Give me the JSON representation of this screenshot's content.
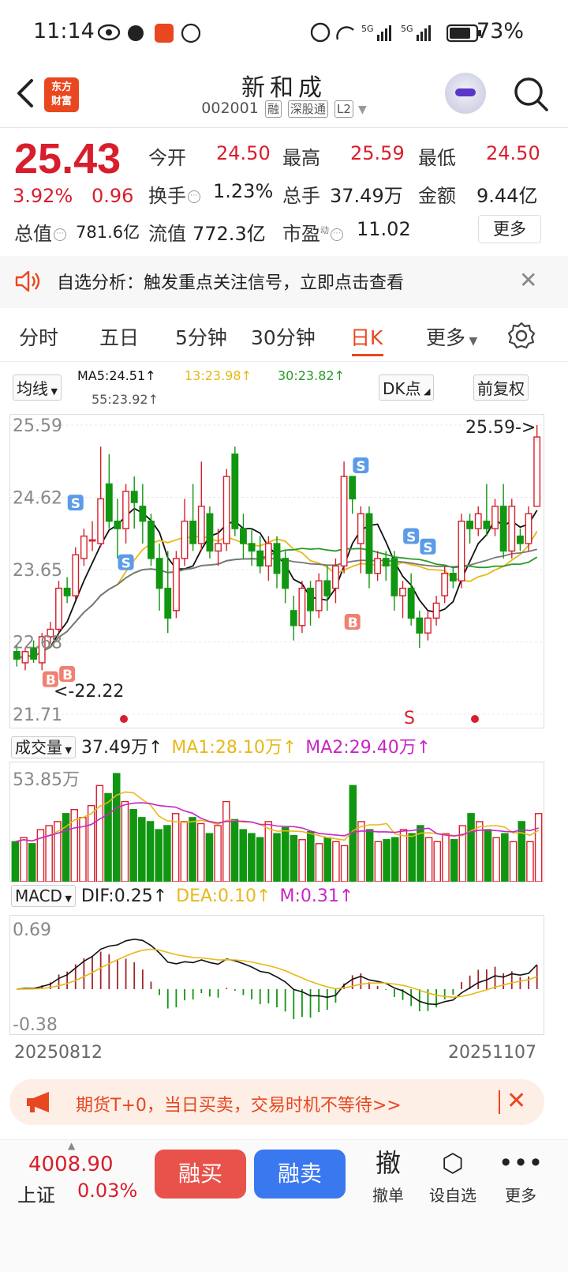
{
  "status_bar": {
    "time": "11:14",
    "battery": "73%"
  },
  "header": {
    "logo_line1": "东方",
    "logo_line2": "财富",
    "stock_name": "新和成",
    "stock_code": "002001",
    "tags": [
      "融",
      "深股通",
      "L2"
    ]
  },
  "quote": {
    "price": "25.43",
    "change_pct": "3.92%",
    "change_amt": "0.96",
    "stats": [
      {
        "label": "今开",
        "value": "24.50",
        "color": "red"
      },
      {
        "label": "最高",
        "value": "25.59",
        "color": "red"
      },
      {
        "label": "最低",
        "value": "24.50",
        "color": "red"
      },
      {
        "label": "换手",
        "value": "1.23%",
        "color": "black"
      },
      {
        "label": "总手",
        "value": "37.49万",
        "color": "black"
      },
      {
        "label": "金额",
        "value": "9.44亿",
        "color": "black"
      },
      {
        "label": "总值",
        "value": "781.6亿",
        "color": "black"
      },
      {
        "label": "流值",
        "value": "772.3亿",
        "color": "black"
      },
      {
        "label": "市盈",
        "value": "11.02",
        "color": "black"
      }
    ],
    "pe_sup": "动",
    "more_label": "更多"
  },
  "notice": {
    "text": "自选分析：触发重点关注信号，立即点击查看"
  },
  "tabs": [
    "分时",
    "五日",
    "5分钟",
    "30分钟",
    "日K",
    "更多"
  ],
  "active_tab": "日K",
  "ma_legend": {
    "selector": "均线",
    "ma5": "MA5:24.51",
    "ma13": "13:23.98",
    "ma30": "30:23.82",
    "ma55": "55:23.92",
    "dk_label": "DK点",
    "adj_label": "前复权"
  },
  "colors": {
    "up": "#d81e2c",
    "down": "#119611",
    "ma5": "#111111",
    "ma13": "#e8b818",
    "ma30": "#2a9a2a",
    "ma55": "#777777",
    "accent": "#e8471f",
    "sell_blue": "#3a78f0"
  },
  "price_chart": {
    "y_labels": [
      "25.59",
      "24.62",
      "23.65",
      "22.68",
      "21.71"
    ],
    "high_marker": "25.59->",
    "low_marker": "22.22",
    "signal_s": "S",
    "signal_b": "B"
  },
  "volume_panel": {
    "selector": "成交量",
    "value": "37.49万",
    "ma1": "MA1:28.10万",
    "ma2": "MA2:29.40万",
    "y_label": "53.85万"
  },
  "macd_panel": {
    "selector": "MACD",
    "dif": "DIF:0.25",
    "dea": "DEA:0.10",
    "m": "M:0.31",
    "y_top": "0.69",
    "y_bottom": "-0.38"
  },
  "date_axis": {
    "start": "20250812",
    "end": "20251107"
  },
  "chart_data": {
    "type": "candlestick",
    "y_range": [
      21.71,
      25.59
    ],
    "candles": [
      {
        "o": 22.55,
        "c": 22.45,
        "h": 22.65,
        "l": 22.35
      },
      {
        "o": 22.4,
        "c": 22.55,
        "h": 22.6,
        "l": 22.3
      },
      {
        "o": 22.6,
        "c": 22.45,
        "h": 22.7,
        "l": 22.4
      },
      {
        "o": 22.4,
        "c": 22.75,
        "h": 22.8,
        "l": 22.3
      },
      {
        "o": 22.75,
        "c": 22.85,
        "h": 22.95,
        "l": 22.65
      },
      {
        "o": 22.85,
        "c": 23.4,
        "h": 23.5,
        "l": 22.8
      },
      {
        "o": 23.4,
        "c": 23.3,
        "h": 23.55,
        "l": 23.2
      },
      {
        "o": 23.3,
        "c": 23.85,
        "h": 23.95,
        "l": 23.25
      },
      {
        "o": 23.8,
        "c": 24.1,
        "h": 24.2,
        "l": 23.7
      },
      {
        "o": 24.05,
        "c": 24.05,
        "h": 24.3,
        "l": 23.9
      },
      {
        "o": 24.0,
        "c": 24.6,
        "h": 25.3,
        "l": 23.95
      },
      {
        "o": 24.8,
        "c": 24.3,
        "h": 25.2,
        "l": 24.2
      },
      {
        "o": 24.3,
        "c": 24.2,
        "h": 24.6,
        "l": 23.8
      },
      {
        "o": 24.2,
        "c": 24.7,
        "h": 24.8,
        "l": 24.0
      },
      {
        "o": 24.7,
        "c": 24.55,
        "h": 24.9,
        "l": 24.2
      },
      {
        "o": 24.5,
        "c": 24.3,
        "h": 24.8,
        "l": 24.0
      },
      {
        "o": 24.3,
        "c": 23.8,
        "h": 24.4,
        "l": 23.7
      },
      {
        "o": 23.8,
        "c": 23.4,
        "h": 24.0,
        "l": 23.1
      },
      {
        "o": 23.4,
        "c": 23.0,
        "h": 23.9,
        "l": 22.8
      },
      {
        "o": 23.1,
        "c": 23.8,
        "h": 23.9,
        "l": 23.0
      },
      {
        "o": 23.8,
        "c": 24.3,
        "h": 24.6,
        "l": 23.7
      },
      {
        "o": 24.3,
        "c": 24.0,
        "h": 24.8,
        "l": 23.9
      },
      {
        "o": 24.0,
        "c": 24.5,
        "h": 25.1,
        "l": 23.9
      },
      {
        "o": 24.4,
        "c": 23.9,
        "h": 24.5,
        "l": 23.8
      },
      {
        "o": 23.9,
        "c": 24.0,
        "h": 24.2,
        "l": 23.7
      },
      {
        "o": 24.0,
        "c": 24.9,
        "h": 25.0,
        "l": 23.9
      },
      {
        "o": 25.2,
        "c": 24.2,
        "h": 25.3,
        "l": 24.1
      },
      {
        "o": 24.2,
        "c": 24.0,
        "h": 24.4,
        "l": 23.8
      },
      {
        "o": 24.0,
        "c": 23.9,
        "h": 24.2,
        "l": 23.7
      },
      {
        "o": 23.9,
        "c": 23.7,
        "h": 24.1,
        "l": 23.6
      },
      {
        "o": 23.7,
        "c": 24.0,
        "h": 24.1,
        "l": 23.5
      },
      {
        "o": 24.0,
        "c": 23.6,
        "h": 24.1,
        "l": 23.4
      },
      {
        "o": 23.8,
        "c": 23.4,
        "h": 23.9,
        "l": 23.2
      },
      {
        "o": 23.1,
        "c": 22.9,
        "h": 23.3,
        "l": 22.7
      },
      {
        "o": 22.9,
        "c": 23.4,
        "h": 23.5,
        "l": 22.8
      },
      {
        "o": 23.4,
        "c": 23.1,
        "h": 23.5,
        "l": 22.9
      },
      {
        "o": 23.1,
        "c": 23.5,
        "h": 23.6,
        "l": 23.0
      },
      {
        "o": 23.5,
        "c": 23.3,
        "h": 23.7,
        "l": 23.1
      },
      {
        "o": 23.4,
        "c": 23.7,
        "h": 23.8,
        "l": 23.2
      },
      {
        "o": 23.7,
        "c": 24.9,
        "h": 25.1,
        "l": 23.6
      },
      {
        "o": 24.9,
        "c": 24.6,
        "h": 24.9,
        "l": 24.4
      },
      {
        "o": 24.0,
        "c": 24.4,
        "h": 24.5,
        "l": 23.6
      },
      {
        "o": 24.4,
        "c": 23.6,
        "h": 24.5,
        "l": 23.4
      },
      {
        "o": 23.6,
        "c": 23.8,
        "h": 23.9,
        "l": 23.5
      },
      {
        "o": 23.8,
        "c": 23.7,
        "h": 23.9,
        "l": 23.5
      },
      {
        "o": 23.8,
        "c": 23.3,
        "h": 23.9,
        "l": 23.1
      },
      {
        "o": 23.3,
        "c": 23.4,
        "h": 23.5,
        "l": 23.0
      },
      {
        "o": 23.4,
        "c": 23.0,
        "h": 23.6,
        "l": 22.9
      },
      {
        "o": 23.0,
        "c": 22.8,
        "h": 23.1,
        "l": 22.6
      },
      {
        "o": 22.8,
        "c": 23.0,
        "h": 23.1,
        "l": 22.7
      },
      {
        "o": 23.0,
        "c": 23.2,
        "h": 23.3,
        "l": 22.9
      },
      {
        "o": 23.3,
        "c": 23.6,
        "h": 23.7,
        "l": 23.2
      },
      {
        "o": 23.6,
        "c": 23.5,
        "h": 23.7,
        "l": 23.4
      },
      {
        "o": 23.5,
        "c": 24.3,
        "h": 24.4,
        "l": 23.4
      },
      {
        "o": 24.3,
        "c": 24.2,
        "h": 24.4,
        "l": 24.0
      },
      {
        "o": 24.2,
        "c": 24.4,
        "h": 24.5,
        "l": 24.1
      },
      {
        "o": 24.3,
        "c": 24.2,
        "h": 24.8,
        "l": 24.1
      },
      {
        "o": 24.2,
        "c": 24.5,
        "h": 24.6,
        "l": 24.1
      },
      {
        "o": 24.5,
        "c": 23.9,
        "h": 24.8,
        "l": 23.8
      },
      {
        "o": 23.9,
        "c": 24.5,
        "h": 24.6,
        "l": 23.8
      },
      {
        "o": 24.1,
        "c": 24.0,
        "h": 24.2,
        "l": 23.9
      },
      {
        "o": 24.0,
        "c": 24.4,
        "h": 24.5,
        "l": 23.9
      },
      {
        "o": 24.5,
        "c": 25.43,
        "h": 25.59,
        "l": 24.5
      }
    ],
    "volume": [
      20,
      22,
      19,
      26,
      28,
      30,
      34,
      36,
      32,
      38,
      48,
      44,
      54,
      40,
      36,
      32,
      30,
      26,
      28,
      34,
      30,
      32,
      29,
      24,
      28,
      40,
      31,
      26,
      24,
      22,
      30,
      24,
      27,
      23,
      21,
      25,
      19,
      22,
      20,
      18,
      48,
      30,
      26,
      20,
      21,
      22,
      26,
      24,
      28,
      22,
      20,
      24,
      21,
      28,
      34,
      30,
      26,
      22,
      24,
      20,
      30,
      20,
      34
    ]
  }
}
